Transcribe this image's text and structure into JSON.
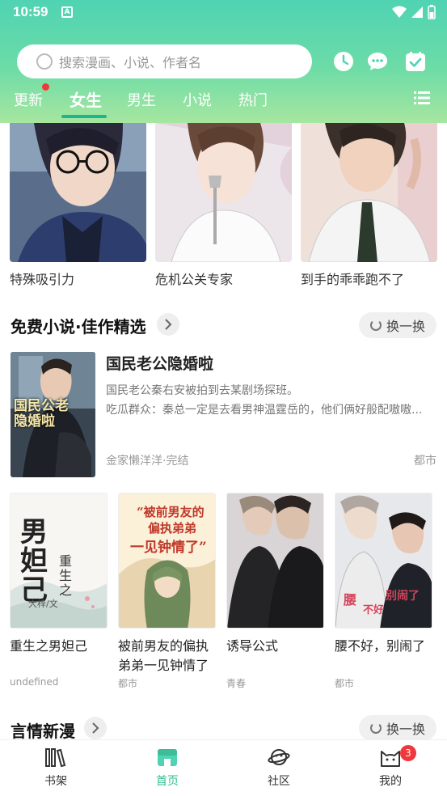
{
  "status_bar": {
    "time": "10:59"
  },
  "search": {
    "placeholder": "搜索漫画、小说、作者名"
  },
  "tabs": [
    {
      "label": "更新"
    },
    {
      "label": "女生"
    },
    {
      "label": "男生"
    },
    {
      "label": "小说"
    },
    {
      "label": "热门"
    }
  ],
  "top_comics": [
    {
      "title": "特殊吸引力"
    },
    {
      "title": "危机公关专家"
    },
    {
      "title": "到手的乖乖跑不了"
    }
  ],
  "section_novels": {
    "title": "免费小说·佳作精选",
    "swap_label": "换一换",
    "featured": {
      "title": "国民老公隐婚啦",
      "cover_text": "国民公老 隐婚啦",
      "desc_line1": "国民老公秦右安被拍到去某剧场探班。",
      "desc_line2": "吃瓜群众：秦总一定是去看男神温霆岳的，他们俩好般配嗷嗷...",
      "meta": "金家懒洋洋·完结",
      "tag": "都市"
    },
    "books": [
      {
        "title": "重生之男妲己",
        "tag": "undefined",
        "cover_text_big": "男妲己",
        "cover_text_small": "重生之",
        "cover_author": "大梓/文"
      },
      {
        "title": "被前男友的偏执弟弟一见钟情了",
        "tag": "都市",
        "cover_text_a": "“被前男友的",
        "cover_text_b": "偏执弟弟",
        "cover_text_c": "一见钟情了”"
      },
      {
        "title": "诱导公式",
        "tag": "青春"
      },
      {
        "title": "腰不好，别闹了",
        "tag": "都市",
        "cover_text_a": "腰",
        "cover_text_b": "不好",
        "cover_text_c": "别闹了"
      }
    ]
  },
  "section_romance": {
    "title": "言情新漫",
    "swap_label": "换一换"
  },
  "bottom_nav": [
    {
      "label": "书架"
    },
    {
      "label": "首页"
    },
    {
      "label": "社区"
    },
    {
      "label": "我的",
      "badge": "3"
    }
  ],
  "colors": {
    "accent": "#2ebf8f",
    "header_start": "#4fd3b3",
    "header_end": "#a7e6a0",
    "badge": "#f0383c"
  }
}
